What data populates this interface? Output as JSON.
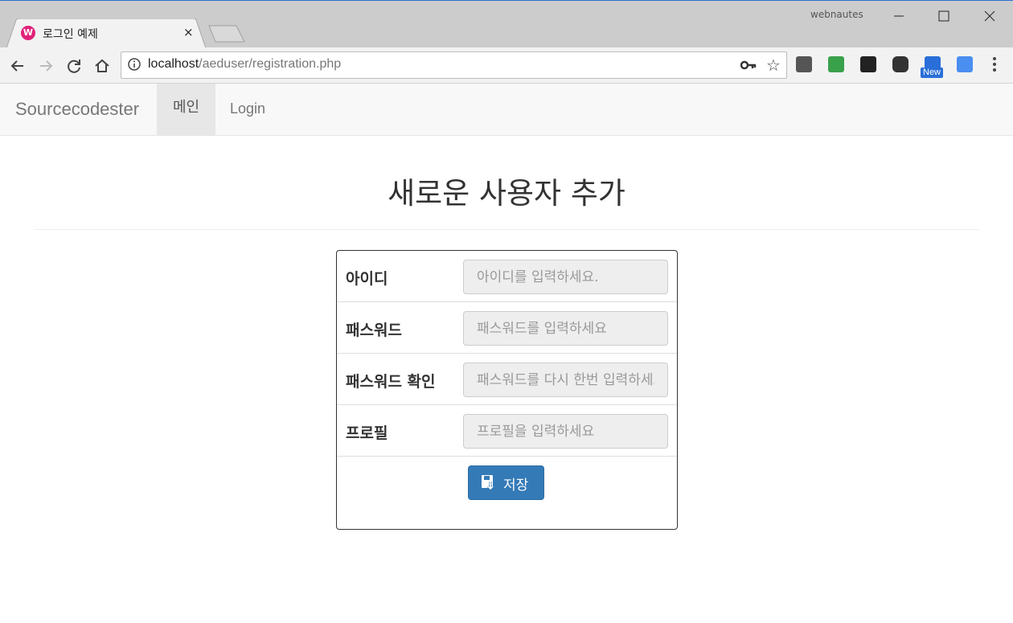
{
  "browser": {
    "tab_title": "로그인 예제",
    "tab_close": "×",
    "window_user": "webnautes",
    "url_host": "localhost",
    "url_path": "/aeduser/registration.php",
    "extension_badge": "New"
  },
  "navbar": {
    "brand": "Sourcecodester",
    "main": "메인",
    "login": "Login"
  },
  "page": {
    "title": "새로운 사용자 추가"
  },
  "form": {
    "fields": [
      {
        "label": "아이디",
        "placeholder": "아이디를 입력하세요."
      },
      {
        "label": "패스워드",
        "placeholder": "패스워드를 입력하세요"
      },
      {
        "label": "패스워드 확인",
        "placeholder": "패스워드를 다시 한번 입력하세요"
      },
      {
        "label": "프로필",
        "placeholder": "프로필을 입력하세요"
      }
    ],
    "save_label": "저장"
  },
  "colors": {
    "accent_primary": "#337ab7",
    "favicon": "#e0227a"
  }
}
